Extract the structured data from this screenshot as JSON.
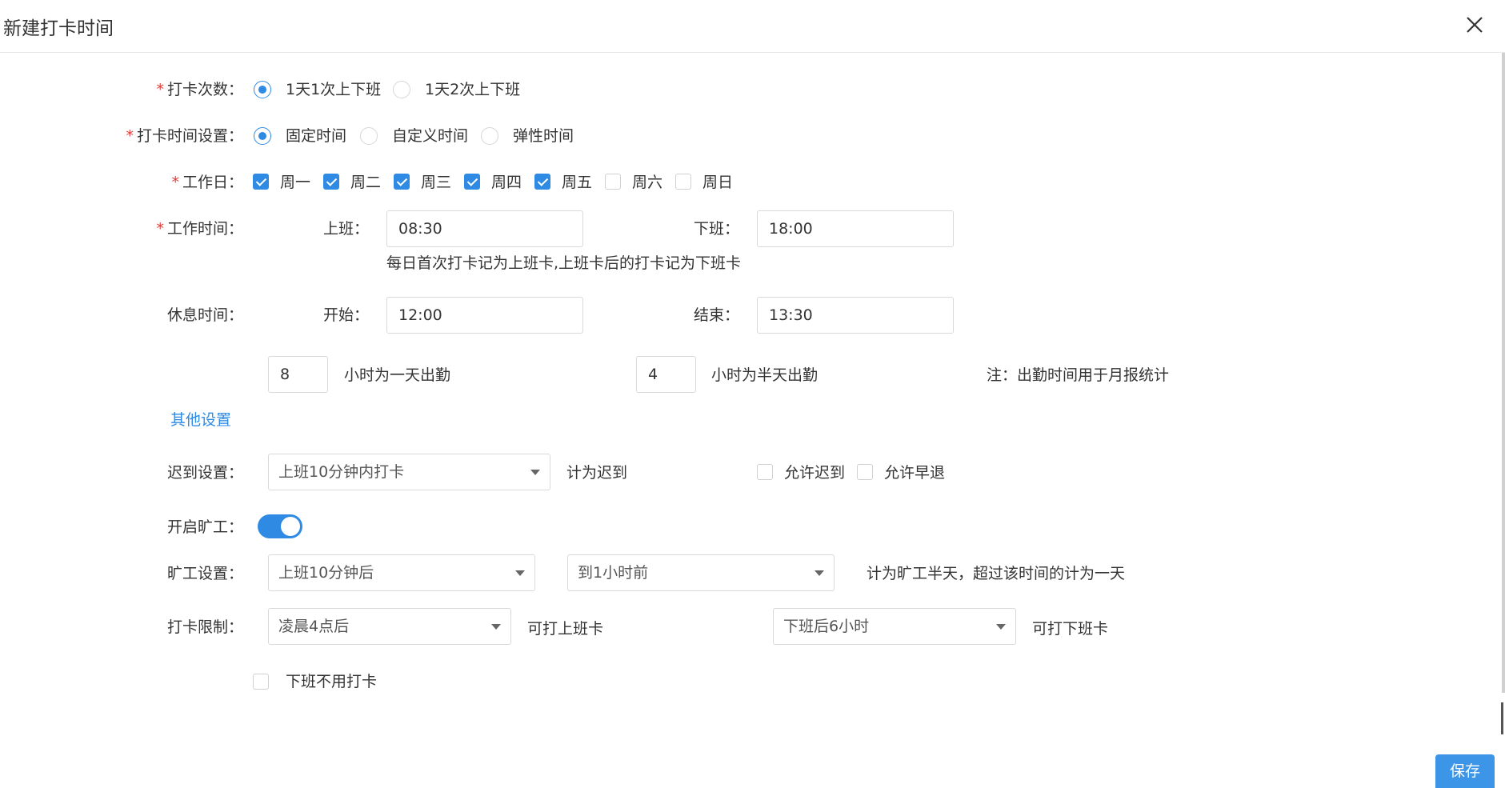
{
  "dialog": {
    "title": "新建打卡时间",
    "close_icon": "close-icon"
  },
  "required_mark": "*",
  "punch_count": {
    "label": "打卡次数：",
    "options": [
      "1天1次上下班",
      "1天2次上下班"
    ],
    "selected": "1天1次上下班"
  },
  "time_setting": {
    "label": "打卡时间设置：",
    "options": [
      "固定时间",
      "自定义时间",
      "弹性时间"
    ],
    "selected": "固定时间"
  },
  "workdays": {
    "label": "工作日：",
    "days": [
      {
        "label": "周一",
        "checked": true
      },
      {
        "label": "周二",
        "checked": true
      },
      {
        "label": "周三",
        "checked": true
      },
      {
        "label": "周四",
        "checked": true
      },
      {
        "label": "周五",
        "checked": true
      },
      {
        "label": "周六",
        "checked": false
      },
      {
        "label": "周日",
        "checked": false
      }
    ]
  },
  "work_time": {
    "label": "工作时间：",
    "start_label": "上班：",
    "start_value": "08:30",
    "end_label": "下班：",
    "end_value": "18:00",
    "hint": "每日首次打卡记为上班卡,上班卡后的打卡记为下班卡"
  },
  "rest_time": {
    "label": "休息时间：",
    "start_label": "开始：",
    "start_value": "12:00",
    "end_label": "结束：",
    "end_value": "13:30"
  },
  "attendance": {
    "full_day_hours": "8",
    "full_day_text": "小时为一天出勤",
    "half_day_hours": "4",
    "half_day_text": "小时为半天出勤",
    "note": "注：出勤时间用于月报统计"
  },
  "other_settings_link": "其他设置",
  "late": {
    "label": "迟到设置：",
    "select_value": "上班10分钟内打卡",
    "suffix": "计为迟到",
    "allow_late": {
      "label": "允许迟到",
      "checked": false
    },
    "allow_early": {
      "label": "允许早退",
      "checked": false
    }
  },
  "absence_toggle": {
    "label": "开启旷工：",
    "on": true
  },
  "absence": {
    "label": "旷工设置：",
    "select1": "上班10分钟后",
    "select2": "到1小时前",
    "suffix": "计为旷工半天，超过该时间的计为一天"
  },
  "punch_limit": {
    "label": "打卡限制：",
    "select1": "凌晨4点后",
    "text1": "可打上班卡",
    "select2": "下班后6小时",
    "text2": "可打下班卡"
  },
  "no_punch_off": {
    "label": "下班不用打卡",
    "checked": false
  },
  "save_label": "保存",
  "colors": {
    "accent": "#2f8ae3",
    "required": "#e53935",
    "save_bg": "#3d95e8"
  }
}
